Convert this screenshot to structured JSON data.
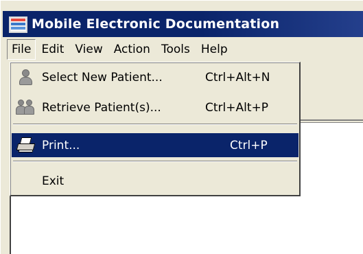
{
  "window": {
    "title": "Mobile Electronic Documentation",
    "icon": "app-icon"
  },
  "menubar": {
    "items": [
      {
        "label": "File",
        "open": true
      },
      {
        "label": "Edit"
      },
      {
        "label": "View"
      },
      {
        "label": "Action"
      },
      {
        "label": "Tools"
      },
      {
        "label": "Help"
      }
    ]
  },
  "file_menu": {
    "items": [
      {
        "label": "Select New Patient...",
        "shortcut": "Ctrl+Alt+N",
        "icon": "person-icon"
      },
      {
        "label": "Retrieve Patient(s)...",
        "shortcut": "Ctrl+Alt+P",
        "icon": "people-icon"
      },
      {
        "label": "Print...",
        "shortcut": "Ctrl+P",
        "icon": "printer-icon",
        "highlighted": true
      },
      {
        "label": "Exit",
        "shortcut": ""
      }
    ]
  },
  "colors": {
    "title_bar": "#0a246a",
    "highlight": "#0a246a",
    "face": "#ece9d8"
  }
}
